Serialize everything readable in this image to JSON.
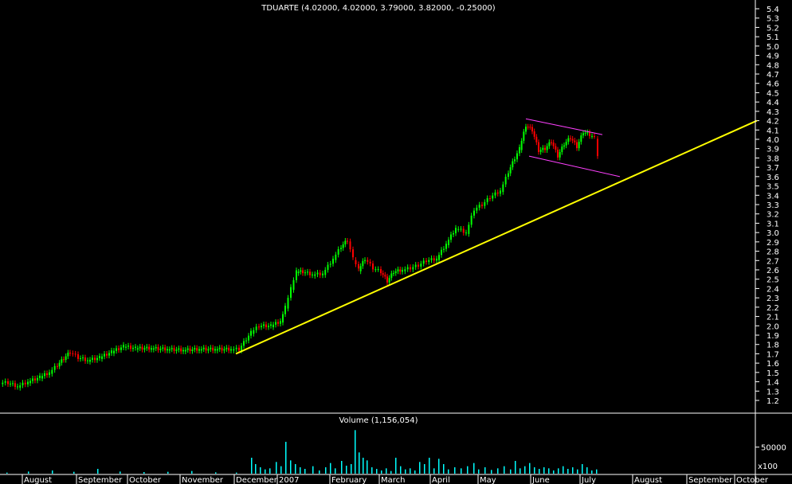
{
  "chart_data": [
    {
      "type": "candlestick",
      "title": "TDUARTE (4.02000, 4.02000, 3.79000, 3.82000, -0.25000)",
      "y_ticks": [
        1.2,
        1.3,
        1.4,
        1.5,
        1.6,
        1.7,
        1.8,
        1.9,
        2.0,
        2.1,
        2.2,
        2.3,
        2.4,
        2.5,
        2.6,
        2.7,
        2.8,
        2.9,
        3.0,
        3.1,
        3.2,
        3.3,
        3.4,
        3.5,
        3.6,
        3.7,
        3.8,
        3.9,
        4.0,
        4.1,
        4.2,
        4.3,
        4.4,
        4.5,
        4.6,
        4.7,
        4.8,
        4.9,
        5.0,
        5.1,
        5.2,
        5.3,
        5.4
      ],
      "ylim": [
        1.15,
        5.45
      ],
      "x_tick_labels": [
        "August",
        "September",
        "October",
        "November",
        "December",
        "2007",
        "February",
        "March",
        "April",
        "May",
        "June",
        "July",
        "August",
        "September",
        "October"
      ],
      "close_series": [
        {
          "x": 0,
          "y": 1.39
        },
        {
          "x": 10,
          "y": 1.39
        },
        {
          "x": 22,
          "y": 1.35
        },
        {
          "x": 35,
          "y": 1.4
        },
        {
          "x": 50,
          "y": 1.45
        },
        {
          "x": 62,
          "y": 1.5
        },
        {
          "x": 72,
          "y": 1.58
        },
        {
          "x": 80,
          "y": 1.65
        },
        {
          "x": 88,
          "y": 1.72
        },
        {
          "x": 98,
          "y": 1.66
        },
        {
          "x": 110,
          "y": 1.63
        },
        {
          "x": 125,
          "y": 1.66
        },
        {
          "x": 140,
          "y": 1.72
        },
        {
          "x": 155,
          "y": 1.78
        },
        {
          "x": 170,
          "y": 1.76
        },
        {
          "x": 190,
          "y": 1.76
        },
        {
          "x": 210,
          "y": 1.75
        },
        {
          "x": 230,
          "y": 1.74
        },
        {
          "x": 250,
          "y": 1.75
        },
        {
          "x": 270,
          "y": 1.75
        },
        {
          "x": 290,
          "y": 1.75
        },
        {
          "x": 300,
          "y": 1.75
        },
        {
          "x": 315,
          "y": 1.93
        },
        {
          "x": 325,
          "y": 2.0
        },
        {
          "x": 340,
          "y": 2.0
        },
        {
          "x": 352,
          "y": 2.05
        },
        {
          "x": 358,
          "y": 2.2
        },
        {
          "x": 365,
          "y": 2.4
        },
        {
          "x": 372,
          "y": 2.58
        },
        {
          "x": 380,
          "y": 2.58
        },
        {
          "x": 392,
          "y": 2.55
        },
        {
          "x": 405,
          "y": 2.56
        },
        {
          "x": 418,
          "y": 2.72
        },
        {
          "x": 428,
          "y": 2.85
        },
        {
          "x": 436,
          "y": 2.92
        },
        {
          "x": 443,
          "y": 2.72
        },
        {
          "x": 450,
          "y": 2.6
        },
        {
          "x": 458,
          "y": 2.72
        },
        {
          "x": 468,
          "y": 2.62
        },
        {
          "x": 478,
          "y": 2.58
        },
        {
          "x": 486,
          "y": 2.48
        },
        {
          "x": 494,
          "y": 2.58
        },
        {
          "x": 505,
          "y": 2.6
        },
        {
          "x": 515,
          "y": 2.62
        },
        {
          "x": 525,
          "y": 2.65
        },
        {
          "x": 535,
          "y": 2.7
        },
        {
          "x": 548,
          "y": 2.72
        },
        {
          "x": 560,
          "y": 2.88
        },
        {
          "x": 572,
          "y": 3.05
        },
        {
          "x": 585,
          "y": 3.0
        },
        {
          "x": 595,
          "y": 3.25
        },
        {
          "x": 605,
          "y": 3.3
        },
        {
          "x": 615,
          "y": 3.38
        },
        {
          "x": 628,
          "y": 3.45
        },
        {
          "x": 638,
          "y": 3.65
        },
        {
          "x": 646,
          "y": 3.8
        },
        {
          "x": 652,
          "y": 3.9
        },
        {
          "x": 660,
          "y": 4.15
        },
        {
          "x": 668,
          "y": 4.1
        },
        {
          "x": 676,
          "y": 3.88
        },
        {
          "x": 684,
          "y": 3.9
        },
        {
          "x": 692,
          "y": 3.98
        },
        {
          "x": 700,
          "y": 3.82
        },
        {
          "x": 708,
          "y": 3.95
        },
        {
          "x": 716,
          "y": 4.02
        },
        {
          "x": 724,
          "y": 3.92
        },
        {
          "x": 732,
          "y": 4.08
        },
        {
          "x": 740,
          "y": 4.05
        },
        {
          "x": 746,
          "y": 4.02
        },
        {
          "x": 750,
          "y": 3.82
        }
      ],
      "trend_lines": [
        {
          "color": "#ffff00",
          "from": {
            "x": 296,
            "y": 1.7
          },
          "to": {
            "x": 950,
            "y": 4.2
          }
        },
        {
          "color": "#ff40ff",
          "from": {
            "x": 660,
            "y": 4.22
          },
          "to": {
            "x": 756,
            "y": 4.05
          }
        },
        {
          "color": "#ff40ff",
          "from": {
            "x": 664,
            "y": 3.82
          },
          "to": {
            "x": 778,
            "y": 3.6
          }
        }
      ],
      "colors": {
        "up": "#00ff00",
        "down": "#ff0000",
        "background": "#000000",
        "axis": "#ffffff"
      }
    },
    {
      "type": "bar",
      "title": "Volume (1,156,054)",
      "y_ticks": [
        50000
      ],
      "unit_label": "x100",
      "ylim": [
        0,
        90000
      ],
      "bars": [
        {
          "x": 8,
          "v": 2000
        },
        {
          "x": 35,
          "v": 4000
        },
        {
          "x": 65,
          "v": 6000
        },
        {
          "x": 92,
          "v": 3500
        },
        {
          "x": 122,
          "v": 9000
        },
        {
          "x": 150,
          "v": 4000
        },
        {
          "x": 180,
          "v": 3000
        },
        {
          "x": 210,
          "v": 3500
        },
        {
          "x": 240,
          "v": 5000
        },
        {
          "x": 270,
          "v": 2500
        },
        {
          "x": 296,
          "v": 2000
        },
        {
          "x": 315,
          "v": 30000
        },
        {
          "x": 320,
          "v": 18000
        },
        {
          "x": 326,
          "v": 12000
        },
        {
          "x": 332,
          "v": 8000
        },
        {
          "x": 338,
          "v": 10000
        },
        {
          "x": 346,
          "v": 22000
        },
        {
          "x": 352,
          "v": 14000
        },
        {
          "x": 358,
          "v": 60000
        },
        {
          "x": 364,
          "v": 25000
        },
        {
          "x": 370,
          "v": 18000
        },
        {
          "x": 376,
          "v": 12000
        },
        {
          "x": 382,
          "v": 9000
        },
        {
          "x": 392,
          "v": 14000
        },
        {
          "x": 400,
          "v": 6000
        },
        {
          "x": 408,
          "v": 12000
        },
        {
          "x": 414,
          "v": 20000
        },
        {
          "x": 420,
          "v": 10000
        },
        {
          "x": 428,
          "v": 24000
        },
        {
          "x": 434,
          "v": 15000
        },
        {
          "x": 440,
          "v": 18000
        },
        {
          "x": 445,
          "v": 82000
        },
        {
          "x": 450,
          "v": 40000
        },
        {
          "x": 455,
          "v": 30000
        },
        {
          "x": 460,
          "v": 25000
        },
        {
          "x": 466,
          "v": 12000
        },
        {
          "x": 472,
          "v": 9000
        },
        {
          "x": 478,
          "v": 6000
        },
        {
          "x": 484,
          "v": 10000
        },
        {
          "x": 490,
          "v": 5000
        },
        {
          "x": 496,
          "v": 30000
        },
        {
          "x": 502,
          "v": 14000
        },
        {
          "x": 508,
          "v": 8000
        },
        {
          "x": 514,
          "v": 10000
        },
        {
          "x": 520,
          "v": 6000
        },
        {
          "x": 526,
          "v": 22000
        },
        {
          "x": 532,
          "v": 18000
        },
        {
          "x": 538,
          "v": 30000
        },
        {
          "x": 544,
          "v": 10000
        },
        {
          "x": 550,
          "v": 28000
        },
        {
          "x": 556,
          "v": 18000
        },
        {
          "x": 562,
          "v": 8000
        },
        {
          "x": 570,
          "v": 12000
        },
        {
          "x": 578,
          "v": 10000
        },
        {
          "x": 586,
          "v": 14000
        },
        {
          "x": 594,
          "v": 20000
        },
        {
          "x": 600,
          "v": 8000
        },
        {
          "x": 608,
          "v": 12000
        },
        {
          "x": 616,
          "v": 7000
        },
        {
          "x": 624,
          "v": 10000
        },
        {
          "x": 632,
          "v": 14000
        },
        {
          "x": 640,
          "v": 8000
        },
        {
          "x": 646,
          "v": 24000
        },
        {
          "x": 652,
          "v": 10000
        },
        {
          "x": 658,
          "v": 14000
        },
        {
          "x": 664,
          "v": 20000
        },
        {
          "x": 670,
          "v": 12000
        },
        {
          "x": 676,
          "v": 9000
        },
        {
          "x": 682,
          "v": 12000
        },
        {
          "x": 688,
          "v": 10000
        },
        {
          "x": 694,
          "v": 6000
        },
        {
          "x": 700,
          "v": 10000
        },
        {
          "x": 706,
          "v": 14000
        },
        {
          "x": 712,
          "v": 9000
        },
        {
          "x": 718,
          "v": 12000
        },
        {
          "x": 724,
          "v": 8000
        },
        {
          "x": 730,
          "v": 18000
        },
        {
          "x": 736,
          "v": 12000
        },
        {
          "x": 742,
          "v": 6000
        },
        {
          "x": 748,
          "v": 8000
        }
      ],
      "bar_color": "#00ffff"
    }
  ]
}
